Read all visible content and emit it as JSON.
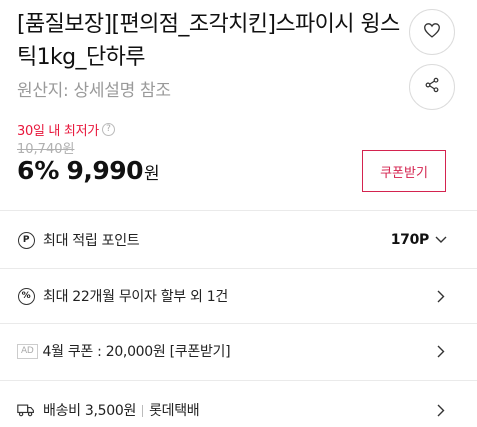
{
  "product": {
    "title": "[품질보장][편의점_조각치킨]스파이시 윙스틱1kg_단하루",
    "origin": "원산지: 상세설명 참조"
  },
  "actions": {
    "like_icon": "heart-icon",
    "share_icon": "share-icon"
  },
  "pricing": {
    "lowest_label": "30일 내 최저가",
    "original_price": "10,740원",
    "discount": "6%",
    "price": "9,990",
    "currency": "원",
    "coupon_button": "쿠폰받기",
    "accent_color": "#d4234f"
  },
  "benefits": [
    {
      "icon": "P",
      "label": "최대 적립 포인트",
      "value": "170P"
    },
    {
      "icon": "%",
      "label": "최대 22개월 무이자 할부 외 1건"
    },
    {
      "badge": "AD",
      "label": "4월 쿠폰 : 20,000원 [쿠폰받기]"
    },
    {
      "icon": "truck-icon",
      "fee": "배송비 3,500원",
      "carrier": "롯데택배"
    }
  ]
}
